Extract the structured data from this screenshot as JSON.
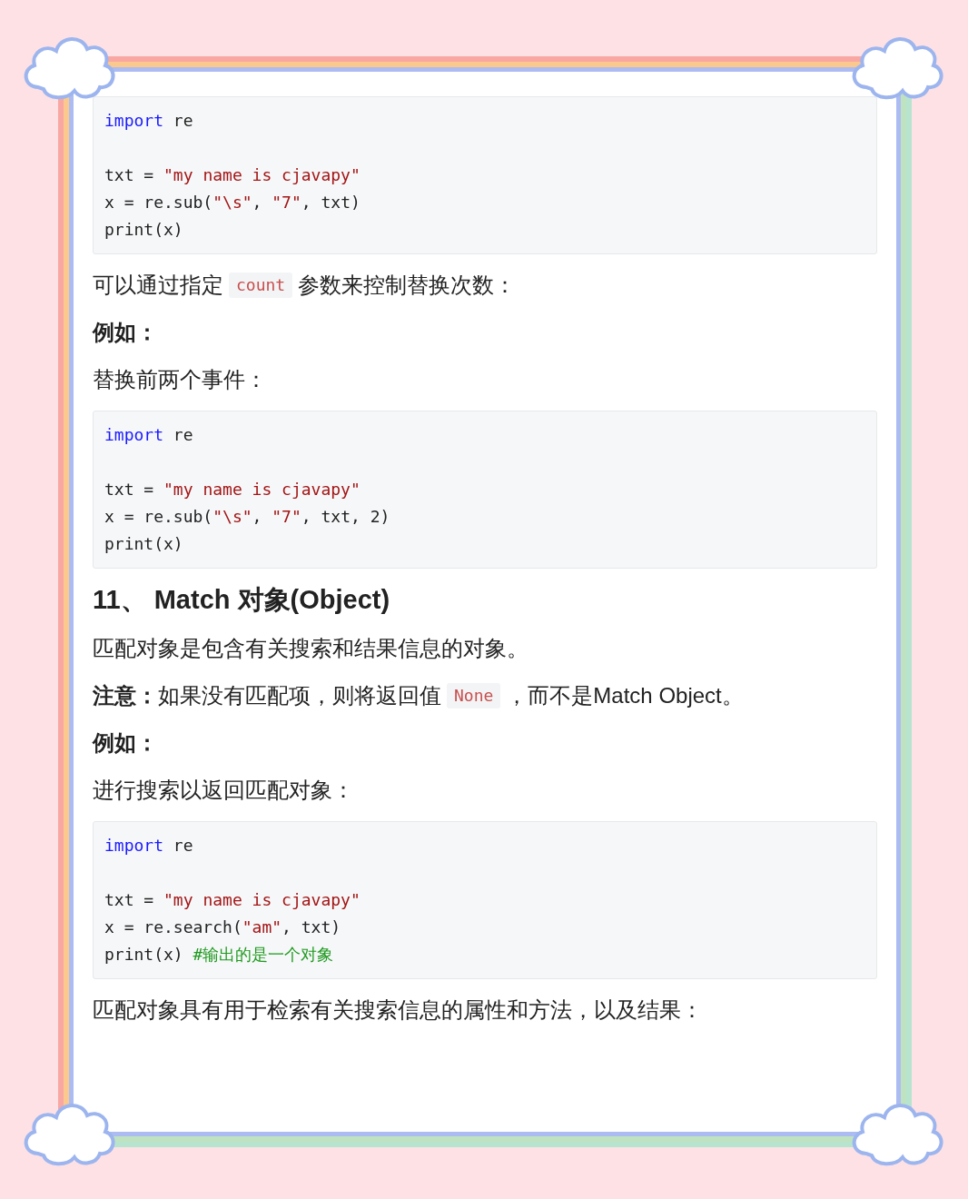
{
  "blocks": [
    {
      "kind": "code",
      "lines": [
        {
          "kind": "code",
          "tokens": [
            {
              "kind": "keyword",
              "text": "import"
            },
            {
              "kind": "plain",
              "text": " re"
            }
          ]
        },
        {
          "kind": "blank"
        },
        {
          "kind": "code",
          "tokens": [
            {
              "kind": "plain",
              "text": "txt = "
            },
            {
              "kind": "string",
              "text": "\"my name is cjavapy\""
            }
          ]
        },
        {
          "kind": "code",
          "tokens": [
            {
              "kind": "plain",
              "text": "x = re.sub("
            },
            {
              "kind": "string",
              "text": "\"\\s\""
            },
            {
              "kind": "plain",
              "text": ", "
            },
            {
              "kind": "string",
              "text": "\"7\""
            },
            {
              "kind": "plain",
              "text": ", txt)"
            }
          ]
        },
        {
          "kind": "code",
          "tokens": [
            {
              "kind": "plain",
              "text": "print(x)"
            }
          ]
        }
      ]
    },
    {
      "kind": "paragraph",
      "segments": [
        {
          "kind": "text",
          "text": "可以通过指定"
        },
        {
          "kind": "code",
          "text": "count"
        },
        {
          "kind": "text",
          "text": "参数来控制替换次数："
        }
      ]
    },
    {
      "kind": "paragraph",
      "segments": [
        {
          "kind": "bold",
          "text": "例如："
        }
      ]
    },
    {
      "kind": "paragraph",
      "segments": [
        {
          "kind": "text",
          "text": "替换前两个事件："
        }
      ]
    },
    {
      "kind": "code",
      "lines": [
        {
          "kind": "code",
          "tokens": [
            {
              "kind": "keyword",
              "text": "import"
            },
            {
              "kind": "plain",
              "text": " re"
            }
          ]
        },
        {
          "kind": "blank"
        },
        {
          "kind": "code",
          "tokens": [
            {
              "kind": "plain",
              "text": "txt = "
            },
            {
              "kind": "string",
              "text": "\"my name is cjavapy\""
            }
          ]
        },
        {
          "kind": "code",
          "tokens": [
            {
              "kind": "plain",
              "text": "x = re.sub("
            },
            {
              "kind": "string",
              "text": "\"\\s\""
            },
            {
              "kind": "plain",
              "text": ", "
            },
            {
              "kind": "string",
              "text": "\"7\""
            },
            {
              "kind": "plain",
              "text": ", txt, 2)"
            }
          ]
        },
        {
          "kind": "code",
          "tokens": [
            {
              "kind": "plain",
              "text": "print(x)"
            }
          ]
        }
      ]
    },
    {
      "kind": "heading",
      "text": "11、 Match 对象(Object)"
    },
    {
      "kind": "paragraph",
      "segments": [
        {
          "kind": "text",
          "text": "匹配对象是包含有关搜索和结果信息的对象。"
        }
      ]
    },
    {
      "kind": "paragraph",
      "segments": [
        {
          "kind": "bold",
          "text": "注意："
        },
        {
          "kind": "text",
          "text": "如果没有匹配项，则将返回值"
        },
        {
          "kind": "code",
          "text": "None"
        },
        {
          "kind": "text",
          "text": "，而不是Match Object。"
        }
      ]
    },
    {
      "kind": "paragraph",
      "segments": [
        {
          "kind": "bold",
          "text": "例如："
        }
      ]
    },
    {
      "kind": "paragraph",
      "segments": [
        {
          "kind": "text",
          "text": "进行搜索以返回匹配对象："
        }
      ]
    },
    {
      "kind": "code",
      "lines": [
        {
          "kind": "code",
          "tokens": [
            {
              "kind": "keyword",
              "text": "import"
            },
            {
              "kind": "plain",
              "text": " re"
            }
          ]
        },
        {
          "kind": "blank"
        },
        {
          "kind": "code",
          "tokens": [
            {
              "kind": "plain",
              "text": "txt = "
            },
            {
              "kind": "string",
              "text": "\"my name is cjavapy\""
            }
          ]
        },
        {
          "kind": "code",
          "tokens": [
            {
              "kind": "plain",
              "text": "x = re.search("
            },
            {
              "kind": "string",
              "text": "\"am\""
            },
            {
              "kind": "plain",
              "text": ", txt)"
            }
          ]
        },
        {
          "kind": "code",
          "tokens": [
            {
              "kind": "plain",
              "text": "print(x) "
            },
            {
              "kind": "comment",
              "text": "#输出的是一个对象"
            }
          ]
        }
      ]
    },
    {
      "kind": "paragraph",
      "segments": [
        {
          "kind": "text",
          "text": "匹配对象具有用于检索有关搜索信息的属性和方法，以及结果："
        }
      ]
    }
  ]
}
